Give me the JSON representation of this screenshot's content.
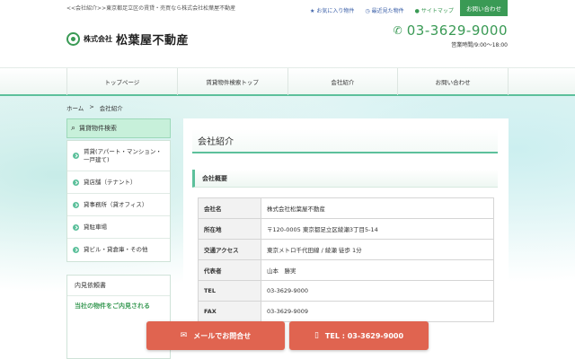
{
  "header": {
    "tagline": "<<会社紹介>>東京都足立区の賃貸・売買なら株式会社松葉屋不動産",
    "logo_prefix": "株式会社",
    "logo_name": "松葉屋不動産",
    "links": {
      "favorites": "お気に入り物件",
      "recent": "最近見た物件",
      "sitemap": "サイトマップ"
    },
    "contact_button": "お問い合わせ",
    "phone": "03-3629-9000",
    "hours": "営業時間/9:00～18:00"
  },
  "nav": {
    "items": [
      "トップページ",
      "賃貸物件検索トップ",
      "会社紹介",
      "お問い合わせ"
    ]
  },
  "breadcrumb": {
    "home": "ホーム",
    "separator": ">",
    "current": "会社紹介"
  },
  "sidebar": {
    "search_title": "賃貸物件検索",
    "items": [
      "賃貸(アパート・マンション・一戸建て)",
      "貸店舗（テナント）",
      "貸事務所（貸オフィス）",
      "貸駐車場",
      "貸ビル・貸倉庫・その他"
    ],
    "box_title": "内見依頼書",
    "box_text": "当社の物件をご内見される"
  },
  "main": {
    "page_title": "会社紹介",
    "section_title": "会社概要",
    "table": [
      {
        "label": "会社名",
        "value": "株式会社松葉屋不動産"
      },
      {
        "label": "所在地",
        "value": "〒120-0005 東京都足立区綾瀬3丁目5-14"
      },
      {
        "label": "交通アクセス",
        "value": "東京メトロ千代田線 / 綾瀬 徒歩 1分"
      },
      {
        "label": "代表者",
        "value": "山本　勝実"
      },
      {
        "label": "TEL",
        "value": "03-3629-9000"
      },
      {
        "label": "FAX",
        "value": "03-3629-9009"
      }
    ]
  },
  "cta": {
    "mail": "メールでお問合せ",
    "tel": "TEL : 03-3629-9000"
  },
  "colors": {
    "brand_green": "#3a9a55",
    "accent_mint": "#5cc09b",
    "cta_red": "#e06450"
  }
}
